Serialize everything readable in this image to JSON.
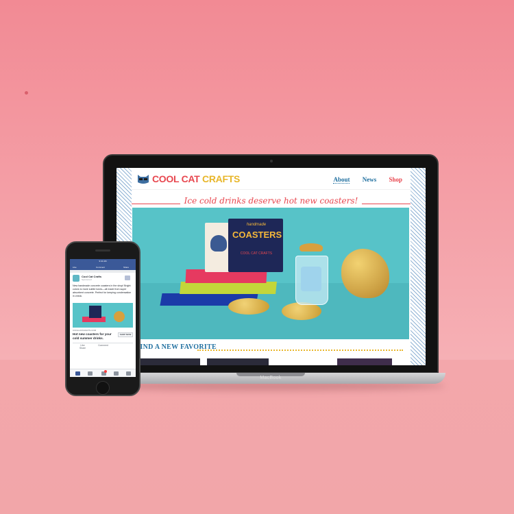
{
  "laptop": {
    "brand": "MacBook",
    "site": {
      "logo": {
        "part1": "COOL CAT",
        "part2": "CRAFTS",
        "icon": "cat-sunglasses-icon"
      },
      "nav": [
        "About",
        "News",
        "Shop"
      ],
      "tagline": "Ice cold drinks deserve hot new coasters!",
      "hero": {
        "box_subtitle": "handmade",
        "box_title": "COASTERS",
        "box_brand": "COOL CAT CRAFTS"
      },
      "section_heading": "FIND A NEW FAVORITE"
    }
  },
  "phone": {
    "status": {
      "time": "9:41 AM"
    },
    "toolbar": {
      "left": "Like",
      "middle": "Comment",
      "right": "Share"
    },
    "post": {
      "page_name": "Cool Cat Crafts",
      "sponsored": "Sponsored",
      "text": "New handmade concrete coasters in the shop! Bright colors to more subtle tones—all made from super absorbent concrete. Perfect for keeping condensation in check.",
      "url": "COOLCATCRAFTS.COM",
      "headline": "Hot new coasters for your cold summer drinks.",
      "cta": "SHOP NOW",
      "actions": [
        "Like",
        "Comment",
        "Share"
      ]
    }
  },
  "colors": {
    "wall": "#f28a94",
    "brand_red": "#e8474f",
    "brand_yellow": "#e8b629",
    "brand_blue": "#1f6f9f",
    "hero_teal": "#57c3c8"
  }
}
